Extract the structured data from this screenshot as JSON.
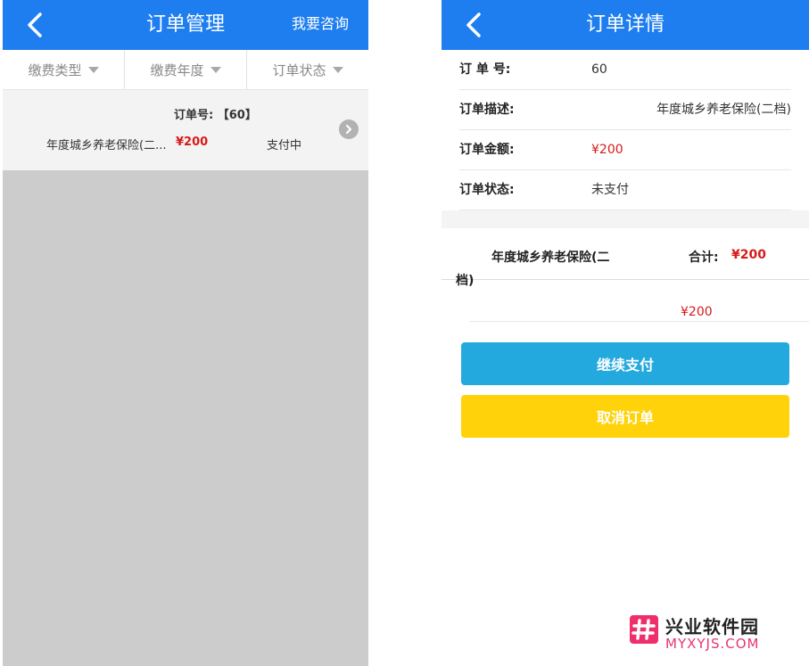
{
  "colors": {
    "nav_blue": "#1e7ef0",
    "price_red": "#d71a1a",
    "pay_button": "#23a9de",
    "cancel_button": "#ffd20a",
    "list_gray": "#cccccc"
  },
  "left": {
    "nav": {
      "back_icon": "chevron-left-icon",
      "title": "订单管理",
      "action": "我要咨询"
    },
    "filters": [
      {
        "label": "缴费类型"
      },
      {
        "label": "缴费年度"
      },
      {
        "label": "订单状态"
      }
    ],
    "order": {
      "number": "订单号: 【60】",
      "desc": "年度城乡养老保险(二...",
      "price": "¥200",
      "status": "支付中",
      "arrow_icon": "chevron-right-circle-icon"
    }
  },
  "right": {
    "nav": {
      "back_icon": "chevron-left-icon",
      "title": "订单详情"
    },
    "rows": [
      {
        "label": "订 单 号:",
        "value": "60"
      },
      {
        "label": "订单描述:",
        "value": "年度城乡养老保险(二档)"
      },
      {
        "label": "订单金额:",
        "value": "¥200"
      },
      {
        "label": "订单状态:",
        "value": "未支付"
      }
    ],
    "item": {
      "name_line1": "年度城乡养老保险(二",
      "name_line2": "档)",
      "total_label": "合计:",
      "total_value": "¥200",
      "sub_price": "¥200"
    },
    "buttons": {
      "pay": "继续支付",
      "cancel": "取消订单"
    }
  },
  "watermark": {
    "cn": "兴业软件园",
    "en": "MYXYJS.COM"
  }
}
